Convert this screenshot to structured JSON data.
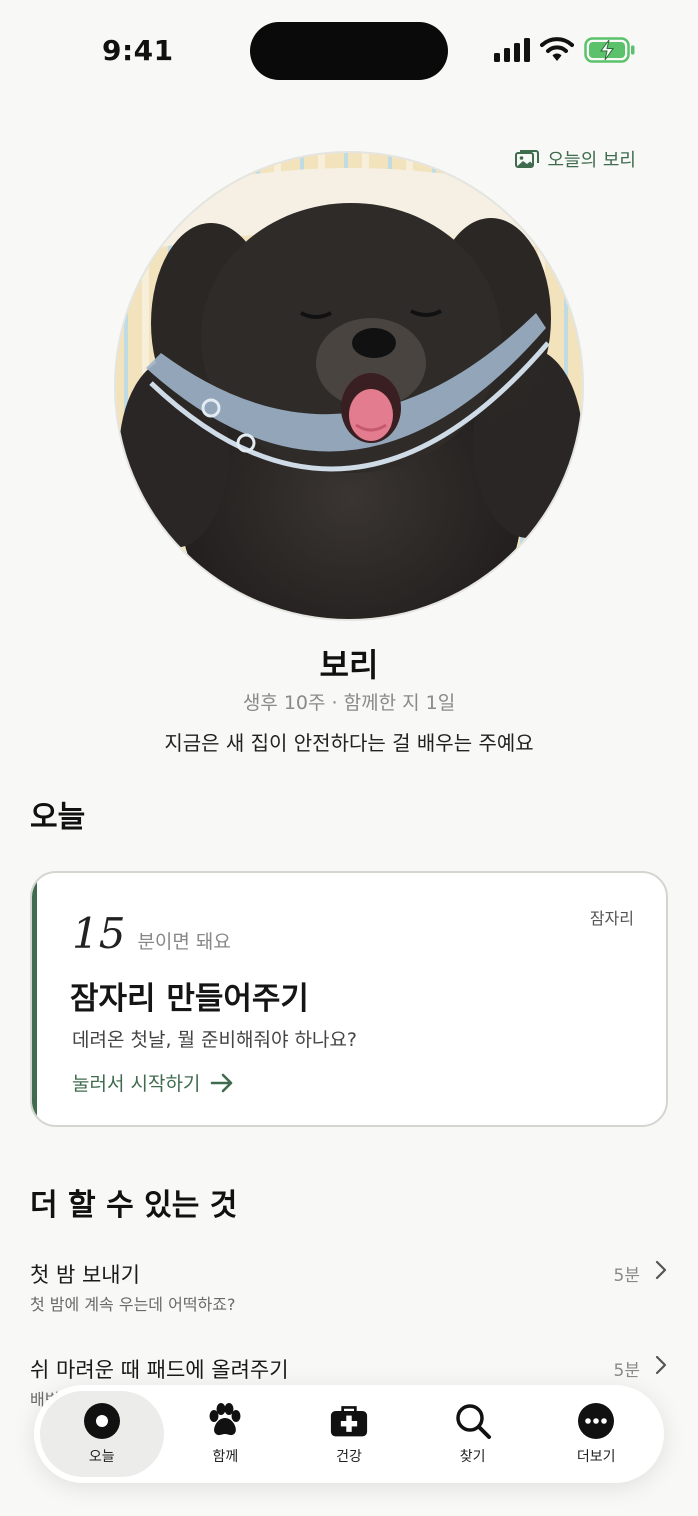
{
  "status_bar": {
    "time": "9:41"
  },
  "header": {
    "gallery_link_label": "오늘의 보리",
    "gallery_icon": "photo-gallery-icon"
  },
  "profile": {
    "name": "보리",
    "meta": "생후 10주 · 함께한 지 1일",
    "tagline": "지금은 새 집이 안전하다는 걸 배우는 주예요"
  },
  "today": {
    "section_title": "오늘",
    "card": {
      "tag": "잠자리",
      "minutes": "15",
      "minutes_suffix": "분이면 돼요",
      "title": "잠자리 만들어주기",
      "subtitle": "데려온 첫날, 뭘 준비해줘야 하나요?",
      "cta": "눌러서 시작하기"
    }
  },
  "more": {
    "section_title": "더 할 수 있는 것",
    "items": [
      {
        "title": "첫 밤 보내기",
        "subtitle": "첫 밤에 계속 우는데 어떡하죠?",
        "duration": "5분"
      },
      {
        "title": "쉬 마려운 때 패드에 올려주기",
        "subtitle": "배변",
        "duration": "5분"
      }
    ]
  },
  "tab_bar": {
    "tabs": [
      {
        "label": "오늘",
        "icon": "today-dot-icon",
        "active": true
      },
      {
        "label": "함께",
        "icon": "paw-icon",
        "active": false
      },
      {
        "label": "건강",
        "icon": "medical-kit-icon",
        "active": false
      },
      {
        "label": "찾기",
        "icon": "search-icon",
        "active": false
      },
      {
        "label": "더보기",
        "icon": "more-dots-icon",
        "active": false
      }
    ]
  },
  "colors": {
    "accent": "#3f6b4e",
    "background": "#f8f8f6",
    "card": "#ffffff"
  }
}
